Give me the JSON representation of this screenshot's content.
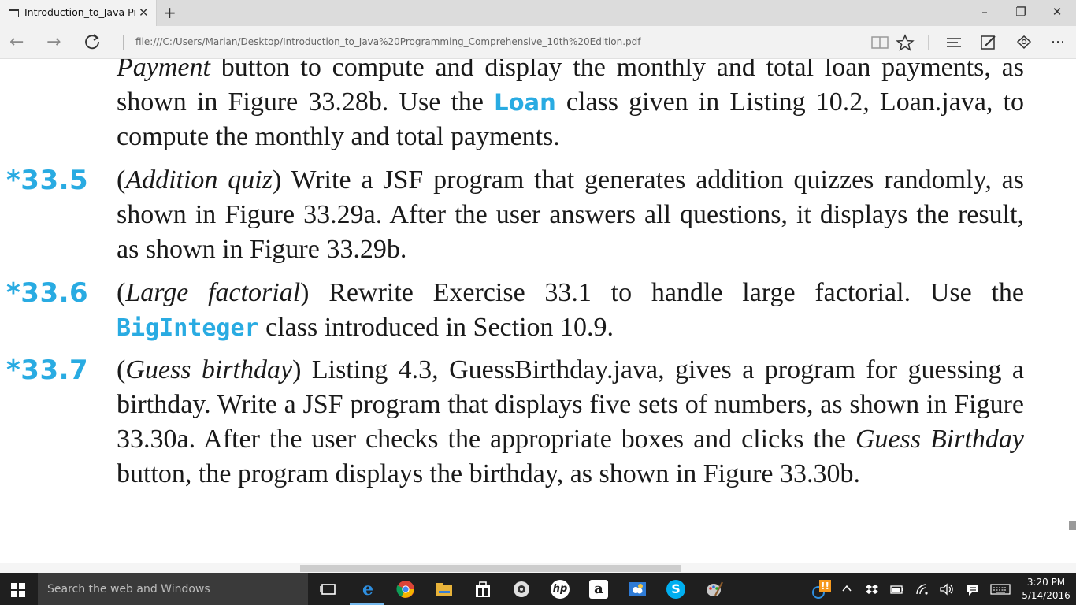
{
  "browser": {
    "tab_title": "Introduction_to_Java Prc",
    "tab_close": "✕",
    "new_tab": "+",
    "url": "file:///C:/Users/Marian/Desktop/Introduction_to_Java%20Programming_Comprehensive_10th%20Edition.pdf",
    "window_controls": {
      "minimize": "–",
      "restore": "❐",
      "close": "✕"
    },
    "nav": {
      "back": "←",
      "forward": "→"
    },
    "toolbar_icons": [
      "reading-view-icon",
      "favorite-star-icon",
      "hub-icon",
      "web-note-icon",
      "share-icon",
      "more-icon"
    ],
    "more": "···"
  },
  "document": {
    "intro": {
      "p1": "Payment",
      "p2": " button to compute and display the monthly and total loan payments, as shown in Figure 33.28b. Use the ",
      "code": "Loan",
      "p3": " class given in Listing 10.2, Loan.java, to compute the monthly and total payments."
    },
    "exercises": [
      {
        "number": "*33.5",
        "open": "(",
        "title": "Addition quiz",
        "rest": ") Write a JSF program that generates addition quizzes randomly, as shown in Figure 33.29a. After the user answers all questions, it displays the result, as shown in Figure 33.29b."
      },
      {
        "number": "*33.6",
        "open": "(",
        "title": "Large factorial",
        "rest": ") Rewrite Exercise 33.1 to handle large factorial. Use the ",
        "code": "BigInteger",
        "rest2": " class introduced in Section 10.9."
      },
      {
        "number": "*33.7",
        "open": "(",
        "title": "Guess birthday",
        "rest": ") Listing 4.3, GuessBirthday.java, gives a program for guessing a birthday. Write a JSF program that displays five sets of numbers, as shown in Figure 33.30a. After the user checks the appropriate boxes and clicks the ",
        "em": "Guess Birthday",
        "rest2": " button, the program displays the birthday, as shown in Figure 33.30b."
      }
    ]
  },
  "taskbar": {
    "search_placeholder": "Search the web and Windows",
    "apps": [
      "task-view",
      "edge",
      "chrome",
      "file-explorer",
      "store",
      "media",
      "hp",
      "amazon",
      "weather",
      "skype",
      "paint"
    ],
    "amazon_label": "a",
    "skype_label": "S",
    "hp_label": "hp",
    "time": "3:20 PM",
    "date": "5/14/2016"
  },
  "colors": {
    "accent": "#29abe2",
    "taskbar": "#1f1f1f"
  }
}
